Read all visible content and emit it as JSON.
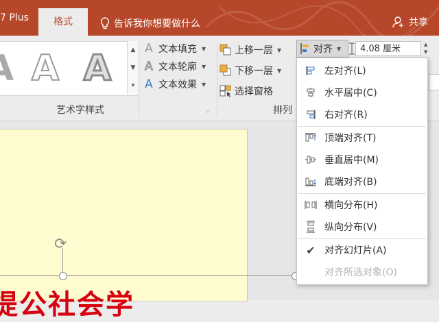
{
  "tabs": {
    "prev_tab": "7 Plus",
    "active_tab": "格式"
  },
  "tell_me": "告诉我你想要做什么",
  "share": "共享",
  "wordart": {
    "gallery_letter": "A",
    "text_fill": "文本填充",
    "text_outline": "文本轮廓",
    "text_effect": "文本效果",
    "group_label": "艺术字样式"
  },
  "arrange": {
    "bring_forward": "上移一层",
    "send_backward": "下移一层",
    "selection_pane": "选择窗格",
    "align": "对齐",
    "group_label": "排列"
  },
  "size": {
    "height_value": "4.08 厘米"
  },
  "align_menu": {
    "items": [
      {
        "label": "左对齐(L)",
        "icon": "align-left-icon"
      },
      {
        "label": "水平居中(C)",
        "icon": "align-center-icon"
      },
      {
        "label": "右对齐(R)",
        "icon": "align-right-icon"
      },
      {
        "label": "顶端对齐(T)",
        "icon": "align-top-icon"
      },
      {
        "label": "垂直居中(M)",
        "icon": "align-middle-icon"
      },
      {
        "label": "底端对齐(B)",
        "icon": "align-bottom-icon"
      },
      {
        "label": "横向分布(H)",
        "icon": "distribute-horizontal-icon"
      },
      {
        "label": "纵向分布(V)",
        "icon": "distribute-vertical-icon"
      },
      {
        "label": "对齐幻灯片(A)",
        "icon": "checkmark-icon",
        "checked": true
      },
      {
        "label": "对齐所选对象(O)",
        "disabled": true
      }
    ]
  },
  "slide": {
    "title_text": "提公社会学"
  },
  "colors": {
    "accent": "#b7472a",
    "slide_bg": "#fffdd0",
    "title_red": "#d6000f"
  }
}
